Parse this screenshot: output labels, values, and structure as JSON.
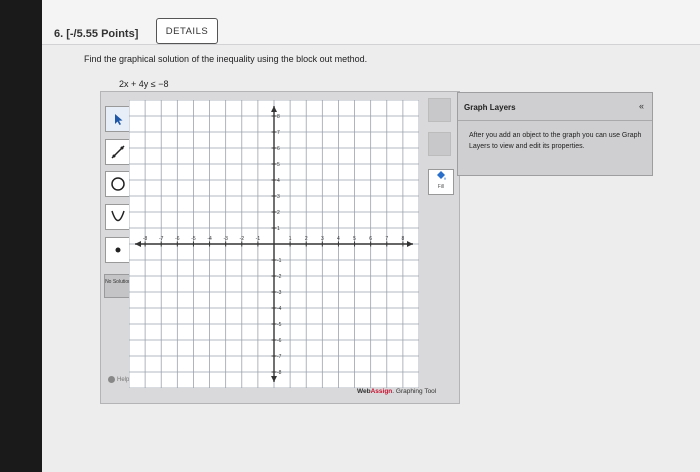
{
  "question": {
    "number_label": "6. [-/5.55 Points]",
    "details_label": "DETAILS",
    "prompt": "Find the graphical solution of the inequality using the block out method.",
    "inequality": "2x + 4y ≤ −8"
  },
  "graph_tool": {
    "tools": [
      {
        "name": "pointer",
        "active": true
      },
      {
        "name": "line"
      },
      {
        "name": "circle"
      },
      {
        "name": "parabola"
      },
      {
        "name": "point"
      }
    ],
    "no_solution_label": "No Solution",
    "help_label": "Help",
    "fill_label": "Fill",
    "axis": {
      "x_ticks": [
        "-8",
        "-7",
        "-6",
        "-5",
        "-4",
        "-3",
        "-2",
        "-1",
        "1",
        "2",
        "3",
        "4",
        "5",
        "6",
        "7",
        "8"
      ],
      "y_ticks": [
        "8",
        "7",
        "6",
        "5",
        "4",
        "3",
        "2",
        "1",
        "-1",
        "-2",
        "-3",
        "-4",
        "-5",
        "-6",
        "-7",
        "-8"
      ]
    },
    "brand_web": "Web",
    "brand_assign": "Assign",
    "brand_suffix": ". Graphing Tool"
  },
  "graph_layers": {
    "title": "Graph Layers",
    "collapse_icon": "«",
    "body": "After you add an object to the graph you can use Graph Layers to view and edit its properties."
  },
  "colors": {
    "accent": "#c8102e",
    "grid_line": "#9aa3ad",
    "axis": "#333333"
  }
}
